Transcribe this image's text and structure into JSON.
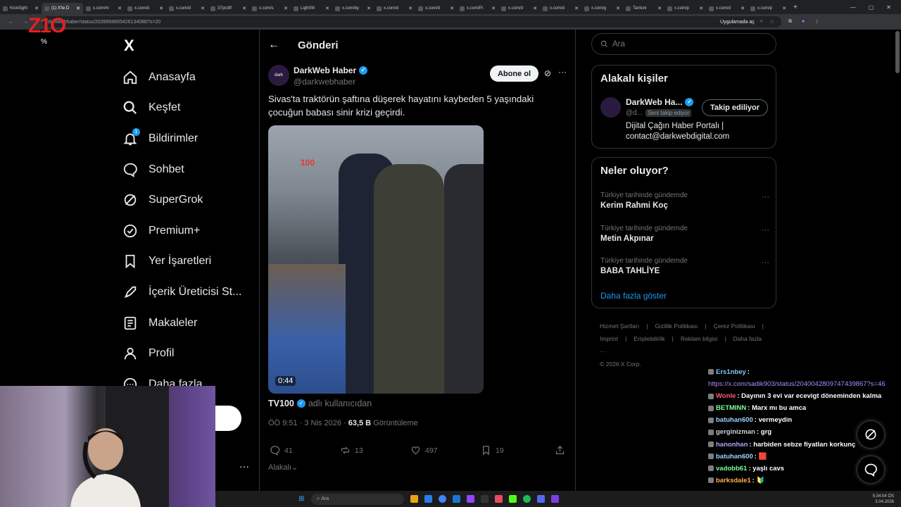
{
  "browser": {
    "tabs": [
      {
        "label": "KickSight"
      },
      {
        "label": "(1) X'te D"
      },
      {
        "label": "x.com/m"
      },
      {
        "label": "x.com/d"
      },
      {
        "label": "x.com/d"
      },
      {
        "label": "37prz8f"
      },
      {
        "label": "x.com/s"
      },
      {
        "label": "LightSh"
      },
      {
        "label": "x.com/by"
      },
      {
        "label": "x.com/d"
      },
      {
        "label": "x.com/d"
      },
      {
        "label": "x.com/Pi"
      },
      {
        "label": "x.com/d"
      },
      {
        "label": "x.com/d"
      },
      {
        "label": "x.com/g"
      },
      {
        "label": "Tantuni"
      },
      {
        "label": "x.com/p"
      },
      {
        "label": "x.com/d"
      },
      {
        "label": "x.com/p"
      }
    ],
    "url": "darkwebhaber/status/2039958855426134088?s=20",
    "app_label": "Uygulamada aç"
  },
  "overlay": {
    "logo": "Z1O",
    "pct": "%"
  },
  "nav": {
    "logo": "X",
    "items": [
      {
        "label": "Anasayfa",
        "icon": "home-icon"
      },
      {
        "label": "Keşfet",
        "icon": "search-icon"
      },
      {
        "label": "Bildirimler",
        "icon": "bell-icon",
        "badge": "1"
      },
      {
        "label": "Sohbet",
        "icon": "chat-icon"
      },
      {
        "label": "SuperGrok",
        "icon": "grok-icon"
      },
      {
        "label": "Premium+",
        "icon": "verified-icon"
      },
      {
        "label": "Yer İşaretleri",
        "icon": "bookmark-icon"
      },
      {
        "label": "İçerik Üreticisi St...",
        "icon": "rocket-icon"
      },
      {
        "label": "Makaleler",
        "icon": "article-icon"
      },
      {
        "label": "Profil",
        "icon": "profile-icon"
      },
      {
        "label": "Daha fazla",
        "icon": "more-icon"
      }
    ]
  },
  "post": {
    "header": "Gönderi",
    "author_name": "DarkWeb Haber",
    "author_handle": "@darkwebhaber",
    "subscribe_label": "Abone ol",
    "text": "Sivas'ta traktörün şaftına düşerek hayatını kaybeden 5 yaşındaki çocuğun babası sinir krizi geçirdi.",
    "video_duration": "0:44",
    "video_badge": "100",
    "source_name": "TV100",
    "source_suffix": "adlı kullanıcıdan",
    "time": "ÖÖ 9:51 · 3 Nis 2026 · ",
    "views": "63,5 B",
    "views_label": " Görüntüleme",
    "replies": "41",
    "reposts": "13",
    "likes": "497",
    "bookmarks": "19",
    "related_label": "Alakalı"
  },
  "right": {
    "search_placeholder": "Ara",
    "related_title": "Alakalı kişiler",
    "person_name": "DarkWeb Ha...",
    "person_handle": "@d...",
    "follows_you": "Seni takip ediyor",
    "follow_label": "Takip ediliyor",
    "person_bio_1": "Dijital Çağın Haber Portalı |",
    "person_bio_2": "contact@darkwebdigital.com",
    "trending_title": "Neler oluyor?",
    "trends": [
      {
        "context": "Türkiye tarihinde gündemde",
        "title": "Kerim Rahmi Koç"
      },
      {
        "context": "Türkiye tarihinde gündemde",
        "title": "Metin Akpınar"
      },
      {
        "context": "Türkiye tarihinde gündemde",
        "title": "BABA TAHLİYE"
      }
    ],
    "show_more": "Daha fazla göster",
    "footer": [
      "Hizmet Şartları",
      "Gizlilik Politikası",
      "Çerez Politikası",
      "Imprint",
      "Erişilebilirlik",
      "Reklam bilgisi",
      "Daha fazla ···",
      "© 2026 X Corp."
    ]
  },
  "chat": [
    {
      "user": "Ers1nbey",
      "msg": "",
      "color": "#7ec8ff"
    },
    {
      "user": "",
      "msg": "https://x.com/sadik903/status/2040042809747439867?s=46",
      "color": "#a98bff",
      "link": true
    },
    {
      "user": "Wonle",
      "msg": "Dayının 3 evi var ecevigt döneminden kalma",
      "color": "#ff5a7a"
    },
    {
      "user": "BETMINN",
      "msg": "Marx mı bu amca",
      "color": "#7dff9a"
    },
    {
      "user": "batuhan600",
      "msg": "vermeydin",
      "color": "#9dd4ff"
    },
    {
      "user": "gerginizman",
      "msg": "grg",
      "color": "#d0d0d0"
    },
    {
      "user": "hanonhan",
      "msg": "harbiden sebze fiyatları korkunç",
      "color": "#b3a3ff"
    },
    {
      "user": "batuhan600",
      "msg": "🟥",
      "color": "#9dd4ff"
    },
    {
      "user": "vadobb61",
      "msg": "yaşlı cavs",
      "color": "#7dff9a"
    },
    {
      "user": "barksdale1",
      "msg": "🔰",
      "color": "#ffb347"
    }
  ],
  "taskbar": {
    "search": "Ara",
    "time": "5:34:04 ÖS",
    "date": "3.04.2026"
  },
  "colors": {
    "accent": "#1d9bf0",
    "background": "#000000",
    "border": "#2f3336",
    "muted": "#71767b"
  }
}
